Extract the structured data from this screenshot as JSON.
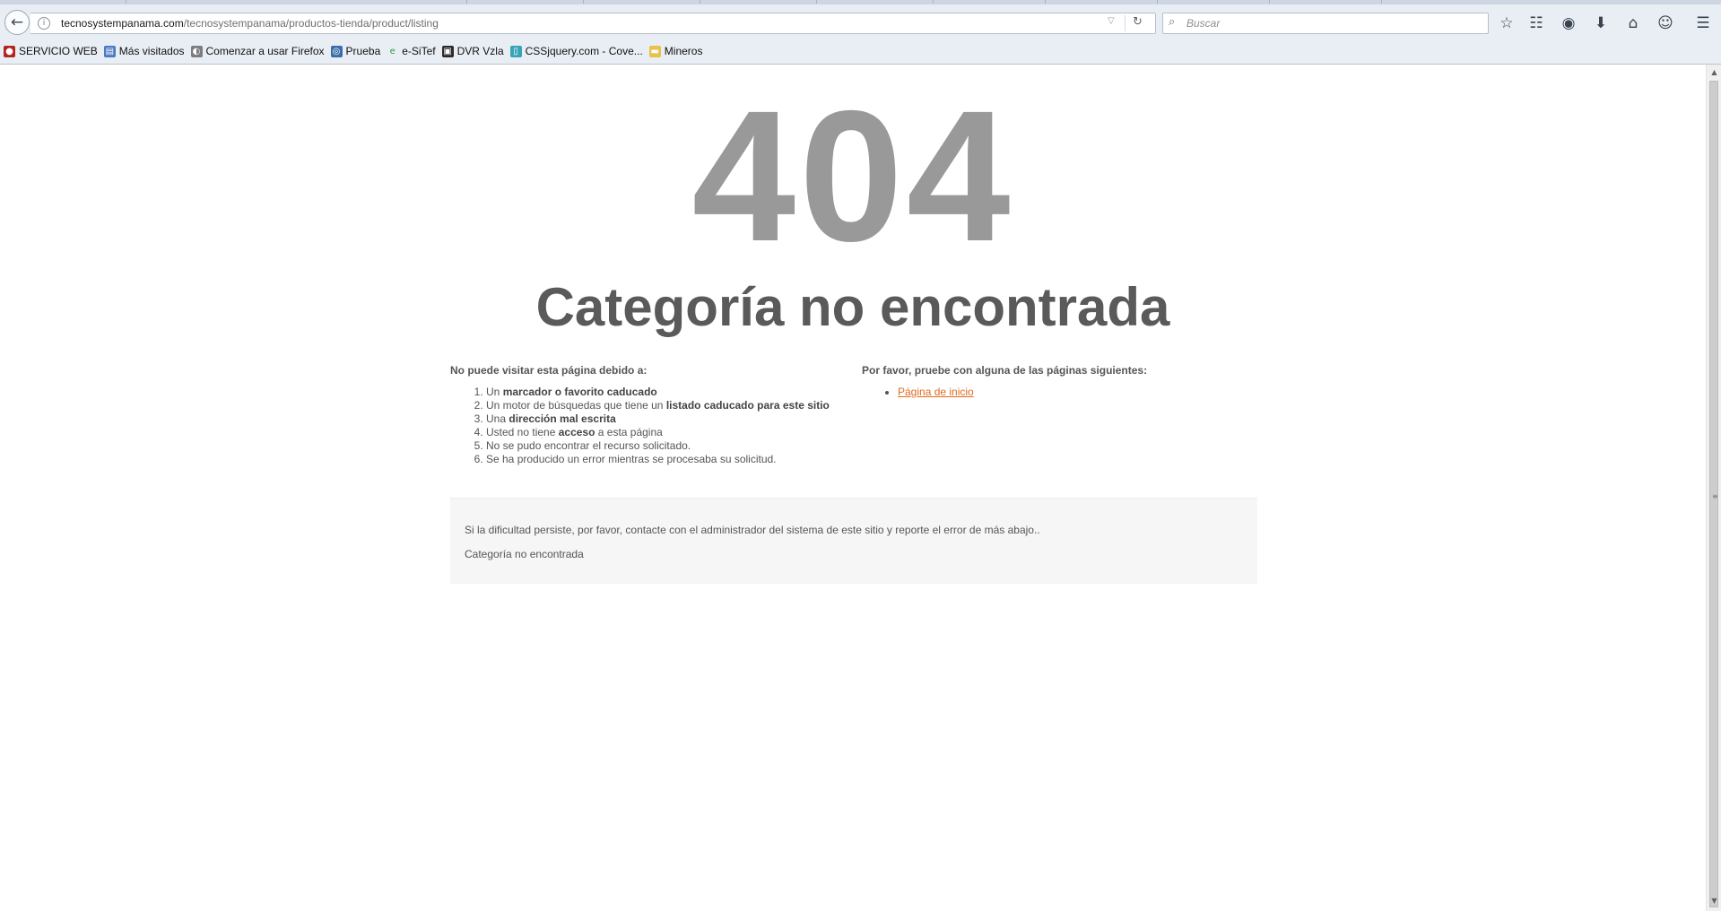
{
  "browser": {
    "url_host": "tecnosystempanama.com",
    "url_path": "/tecnosystempanama/productos-tienda/product/listing",
    "search_placeholder": "Buscar",
    "bookmarks": [
      {
        "label": "SERVICIO WEB",
        "icon": "red-circle-icon",
        "color": "#b3261e"
      },
      {
        "label": "Más visitados",
        "icon": "bookmark-folder-icon",
        "color": "#4a78c2"
      },
      {
        "label": "Comenzar a usar Firefox",
        "icon": "firefox-icon",
        "color": "#7d7d7d"
      },
      {
        "label": "Prueba",
        "icon": "globe-icon",
        "color": "#3b6ea8"
      },
      {
        "label": "e-SiTef",
        "icon": "e-logo-icon",
        "color": "#2f9a39"
      },
      {
        "label": "DVR Vzla",
        "icon": "camera-icon",
        "color": "#2b2b2b"
      },
      {
        "label": "CSSjquery.com - Cove...",
        "icon": "page-icon",
        "color": "#3aa3b8"
      },
      {
        "label": "Mineros",
        "icon": "folder-icon",
        "color": "#e8c24a"
      }
    ]
  },
  "error": {
    "code": "404",
    "title": "Categoría no encontrada",
    "reasons_heading": "No puede visitar esta página debido a:",
    "reasons": [
      {
        "pre": "Un ",
        "bold": "marcador o favorito caducado",
        "post": ""
      },
      {
        "pre": "Un motor de búsquedas que tiene un ",
        "bold": "listado caducado para este sitio",
        "post": ""
      },
      {
        "pre": "Una ",
        "bold": "dirección mal escrita",
        "post": ""
      },
      {
        "pre": "Usted no tiene ",
        "bold": "acceso",
        "post": " a esta página"
      },
      {
        "pre": "No se pudo encontrar el recurso solicitado.",
        "bold": "",
        "post": ""
      },
      {
        "pre": "Se ha producido un error mientras se procesaba su solicitud.",
        "bold": "",
        "post": ""
      }
    ],
    "suggest_heading": "Por favor, pruebe con alguna de las páginas siguientes:",
    "home_link": "Página de inicio",
    "contact_text": "Si la dificultad persiste, por favor, contacte con el administrador del sistema de este sitio y reporte el error de más abajo..",
    "error_message": "Categoría no encontrada"
  },
  "colors": {
    "code": "#999999",
    "title": "#5a5a5a",
    "link": "#e06b1f",
    "box_bg": "#f6f6f6"
  }
}
